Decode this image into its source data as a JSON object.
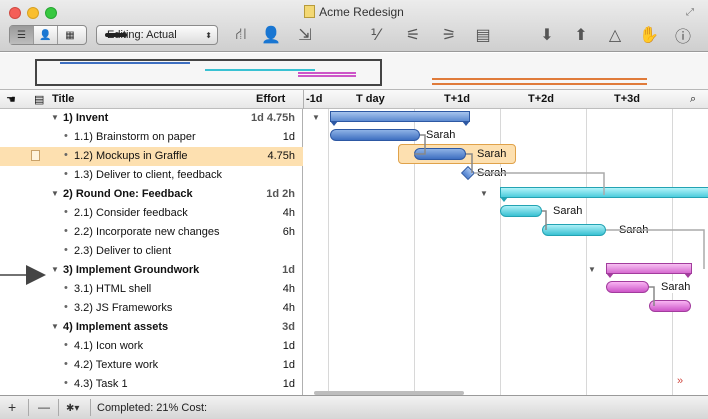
{
  "window": {
    "title": "Acme Redesign"
  },
  "toolbar": {
    "editing_label": "Editing: Actual"
  },
  "header": {
    "title_label": "Title",
    "effort_label": "Effort",
    "timeline": [
      "-1d",
      "T day",
      "T+1d",
      "T+2d",
      "T+3d"
    ]
  },
  "rows": [
    {
      "title": "1)  Invent",
      "effort": "1d 4.75h",
      "group": true
    },
    {
      "title": "1.1)  Brainstorm on paper",
      "effort": "1d",
      "group": false
    },
    {
      "title": "1.2)  Mockups in Graffle",
      "effort": "4.75h",
      "group": false,
      "selected": true
    },
    {
      "title": "1.3)  Deliver to client, feedback",
      "effort": "",
      "group": false
    },
    {
      "title": "2)  Round One: Feedback",
      "effort": "1d 2h",
      "group": true
    },
    {
      "title": "2.1)  Consider feedback",
      "effort": "4h",
      "group": false
    },
    {
      "title": "2.2)  Incorporate new changes",
      "effort": "6h",
      "group": false
    },
    {
      "title": "2.3)  Deliver to client",
      "effort": "",
      "group": false
    },
    {
      "title": "3)  Implement Groundwork",
      "effort": "1d",
      "group": true
    },
    {
      "title": "3.1)  HTML shell",
      "effort": "4h",
      "group": false
    },
    {
      "title": "3.2)  JS Frameworks",
      "effort": "4h",
      "group": false
    },
    {
      "title": "4)  Implement assets",
      "effort": "3d",
      "group": true
    },
    {
      "title": "4.1)  Icon work",
      "effort": "1d",
      "group": false
    },
    {
      "title": "4.2)  Texture work",
      "effort": "1d",
      "group": false
    },
    {
      "title": "4.3)  Task 1",
      "effort": "1d",
      "group": false
    }
  ],
  "gantt_labels": {
    "sarah": "Sarah"
  },
  "footer": {
    "status": "Completed: 21% Cost:",
    "add": "+",
    "remove": "—",
    "gear": "✱▾"
  },
  "colors": {
    "blue": "#3e6fc0",
    "cyan": "#39c1d2",
    "pink": "#cd55c8",
    "selection": "#fde0b0"
  }
}
